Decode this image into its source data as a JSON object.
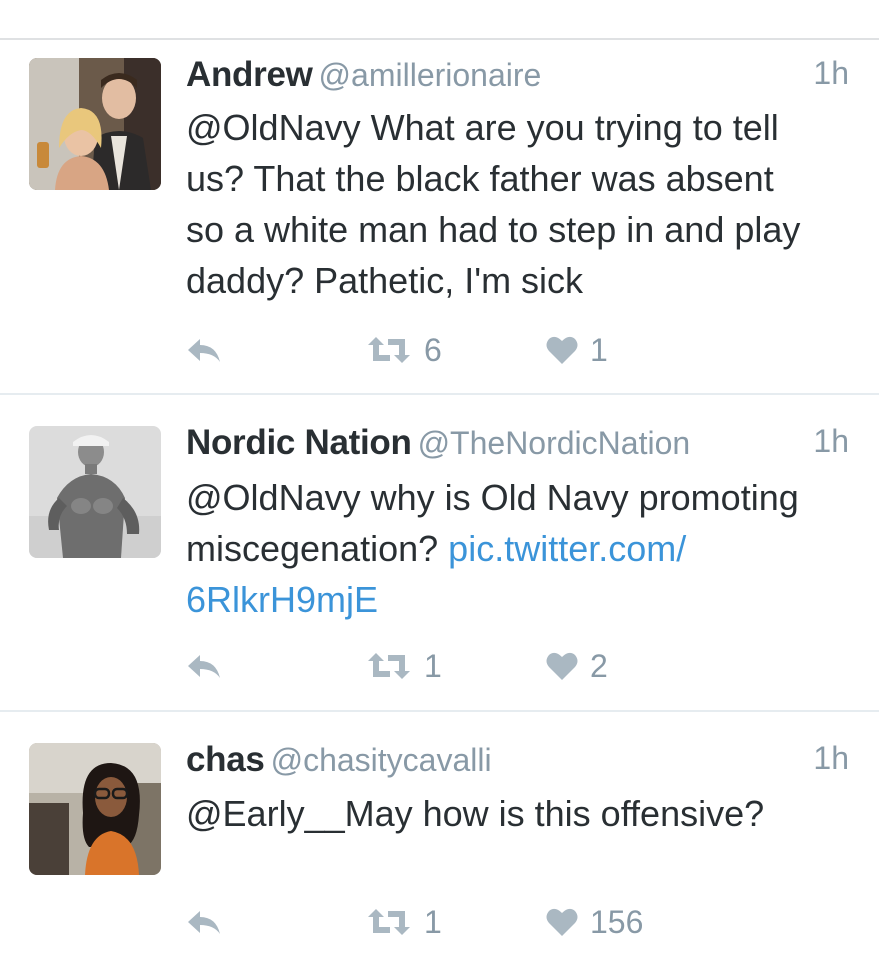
{
  "tweets": [
    {
      "name": "Andrew",
      "handle": "@amillerionaire",
      "time": "1h",
      "text_lines": [
        "@OldNavy What are you trying to tell",
        "us? That the black father was absent",
        "so a white man had to step in and play",
        "daddy? Pathetic, I'm sick"
      ],
      "retweets": "6",
      "likes": "1"
    },
    {
      "name": "Nordic Nation",
      "handle": "@TheNordicNation",
      "time": "1h",
      "text_line1": "@OldNavy why is Old Navy promoting",
      "text_line2_plain": "miscegenation? ",
      "link_line1": "pic.twitter.com/",
      "link_line2": "6RlkrH9mjE",
      "retweets": "1",
      "likes": "2"
    },
    {
      "name": "chas",
      "handle": "@chasitycavalli",
      "time": "1h",
      "text_lines": [
        "@Early__May how is this offensive?"
      ],
      "retweets": "1",
      "likes": "156"
    }
  ],
  "icons": {
    "reply": "reply-icon",
    "retweet": "retweet-icon",
    "like": "heart-icon"
  },
  "colors": {
    "text": "#292f33",
    "secondary": "#8899a6",
    "icon": "#aab8c2",
    "link": "#3b94d9",
    "divider": "#e6ecf0"
  }
}
